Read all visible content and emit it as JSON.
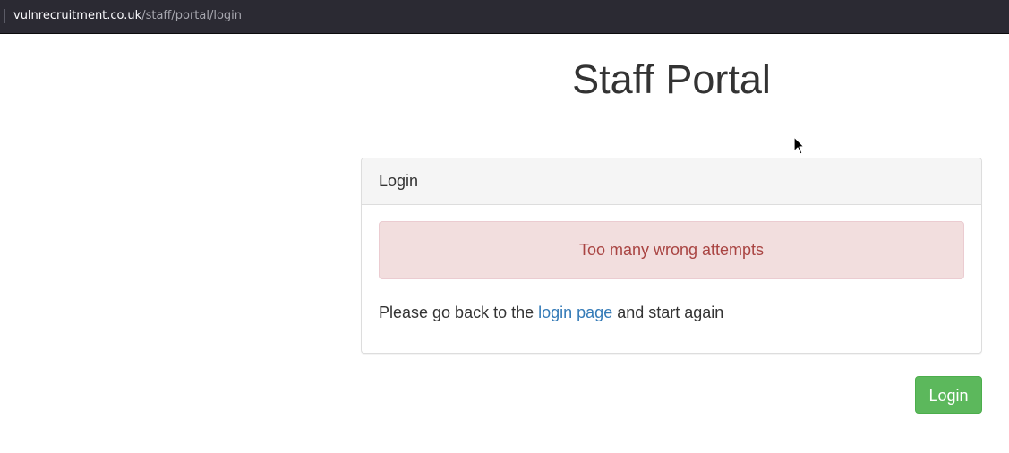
{
  "browser": {
    "url_host": "vulnrecruitment.co.uk",
    "url_path": "/staff/portal/login"
  },
  "page": {
    "title": "Staff Portal"
  },
  "panel": {
    "heading": "Login",
    "alert_text": "Too many wrong attempts",
    "message_before": "Please go back to the ",
    "message_link": "login page",
    "message_after": " and start again"
  },
  "actions": {
    "login_label": "Login"
  },
  "colors": {
    "alert_bg": "#f2dede",
    "alert_text": "#a94442",
    "link": "#337ab7",
    "button": "#5cb85c"
  }
}
